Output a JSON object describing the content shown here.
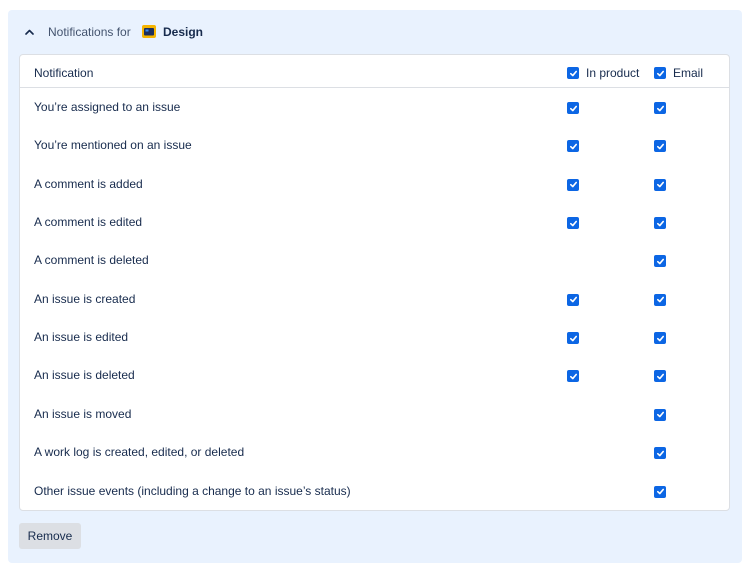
{
  "header": {
    "prefix": "Notifications for",
    "project_name": "Design",
    "project_icon": "project-folder-icon"
  },
  "table": {
    "col_notification": "Notification",
    "col_in_product": "In product",
    "col_email": "Email",
    "header_in_product_checked": true,
    "header_email_checked": true,
    "rows": [
      {
        "label": "You’re assigned to an issue",
        "in_product": true,
        "email": true
      },
      {
        "label": "You’re mentioned on an issue",
        "in_product": true,
        "email": true
      },
      {
        "label": "A comment is added",
        "in_product": true,
        "email": true
      },
      {
        "label": "A comment is edited",
        "in_product": true,
        "email": true
      },
      {
        "label": "A comment is deleted",
        "in_product": false,
        "email": true
      },
      {
        "label": "An issue is created",
        "in_product": true,
        "email": true
      },
      {
        "label": "An issue is edited",
        "in_product": true,
        "email": true
      },
      {
        "label": "An issue is deleted",
        "in_product": true,
        "email": true
      },
      {
        "label": "An issue is moved",
        "in_product": false,
        "email": true
      },
      {
        "label": "A work log is created, edited, or deleted",
        "in_product": false,
        "email": true
      },
      {
        "label": "Other issue events (including a change to an issue’s status)",
        "in_product": false,
        "email": true
      }
    ]
  },
  "actions": {
    "remove_label": "Remove"
  },
  "colors": {
    "panel_bg": "#e9f2fe",
    "checkbox": "#0c66e4",
    "text": "#172b4d"
  }
}
